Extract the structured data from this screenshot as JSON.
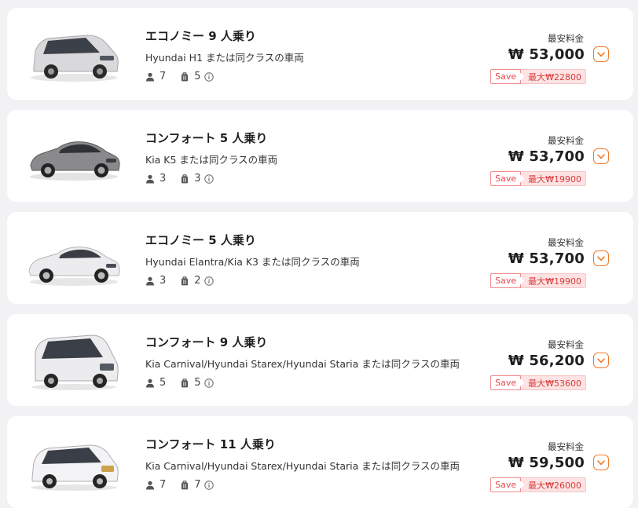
{
  "colors": {
    "accent": "#ef7a2b",
    "save_text": "#e5484d",
    "save_bg": "#fde3e3",
    "card_bg": "#ffffff",
    "page_bg": "#f2f2f5"
  },
  "cars": [
    {
      "title": "エコノミー 9 人乗り",
      "subtitle": "Hyundai H1 または同クラスの車両",
      "passengers": "7",
      "luggage": "5",
      "price_label": "最安料金",
      "price": "₩ 53,000",
      "save_label": "Save",
      "save_amount": "最大₩22800",
      "image_icon": "van-icon",
      "car_color": "#d8d8da"
    },
    {
      "title": "コンフォート 5 人乗り",
      "subtitle": "Kia K5 または同クラスの車両",
      "passengers": "3",
      "luggage": "3",
      "price_label": "最安料金",
      "price": "₩ 53,700",
      "save_label": "Save",
      "save_amount": "最大₩19900",
      "image_icon": "sedan-icon",
      "car_color": "#8a8a8c"
    },
    {
      "title": "エコノミー 5 人乗り",
      "subtitle": "Hyundai Elantra/Kia K3 または同クラスの車両",
      "passengers": "3",
      "luggage": "2",
      "price_label": "最安料金",
      "price": "₩ 53,700",
      "save_label": "Save",
      "save_amount": "最大₩19900",
      "image_icon": "sedan-icon",
      "car_color": "#e6e6e8"
    },
    {
      "title": "コンフォート 9 人乗り",
      "subtitle": "Kia Carnival/Hyundai Starex/Hyundai Staria または同クラスの車両",
      "passengers": "5",
      "luggage": "5",
      "price_label": "最安料金",
      "price": "₩ 56,200",
      "save_label": "Save",
      "save_amount": "最大₩53600",
      "image_icon": "minibus-icon",
      "car_color": "#e9e9ec"
    },
    {
      "title": "コンフォート 11 人乗り",
      "subtitle": "Kia Carnival/Hyundai Starex/Hyundai Staria または同クラスの車両",
      "passengers": "7",
      "luggage": "7",
      "price_label": "最安料金",
      "price": "₩ 59,500",
      "save_label": "Save",
      "save_amount": "最大₩26000",
      "image_icon": "minivan-icon",
      "car_color": "#f1f1f3"
    }
  ]
}
